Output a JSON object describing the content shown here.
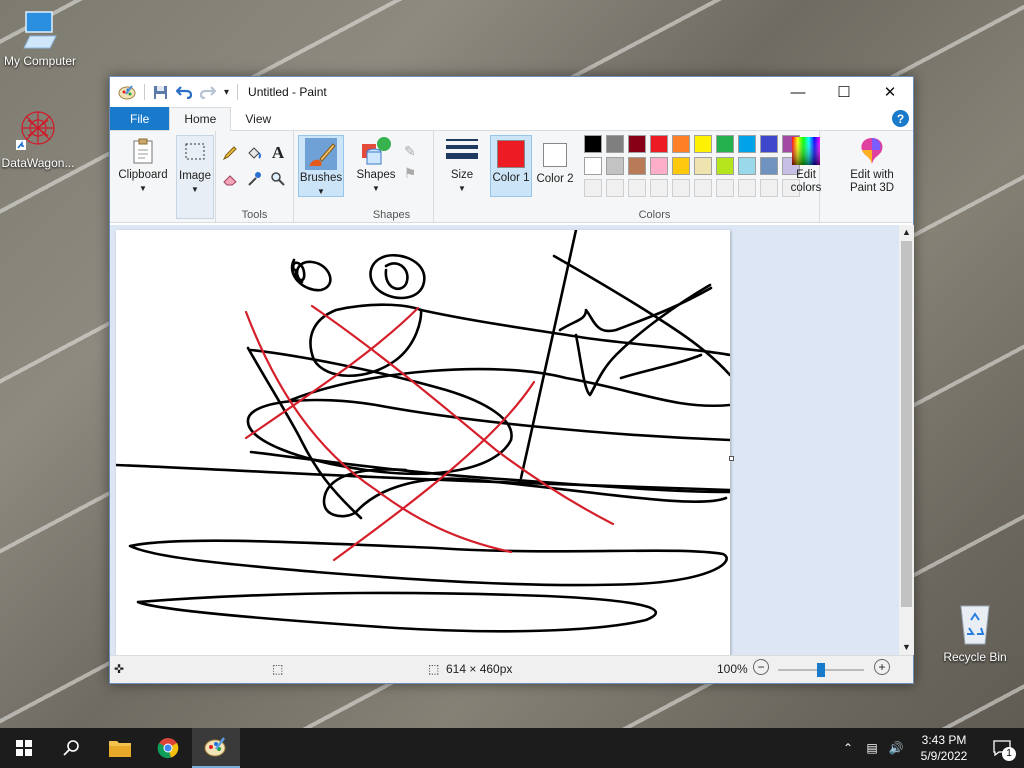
{
  "desktop": {
    "icons": [
      {
        "label": "My Computer",
        "icon": "computer-icon"
      },
      {
        "label": "DataWagon...",
        "icon": "datawagon-icon"
      },
      {
        "label": "Recycle Bin",
        "icon": "recycle-bin-icon"
      }
    ]
  },
  "window": {
    "title": "Untitled - Paint",
    "tabs": [
      "File",
      "Home",
      "View"
    ],
    "ribbon": {
      "clipboard": "Clipboard",
      "image": "Image",
      "tools_group": "Tools",
      "brushes": "Brushes",
      "shapes_btn": "Shapes",
      "shapes_group": "Shapes",
      "size": "Size",
      "color1": "Color 1",
      "color2": "Color 2",
      "colors_group": "Colors",
      "edit_colors": "Edit colors",
      "edit_paint3d": "Edit with Paint 3D",
      "color1_value": "#ed1c24",
      "color2_value": "#ffffff",
      "palette_row1": [
        "#000000",
        "#7f7f7f",
        "#880015",
        "#ed1c24",
        "#ff7f27",
        "#fff200",
        "#22b14c",
        "#00a2e8",
        "#3f48cc",
        "#a349a4"
      ],
      "palette_row2": [
        "#ffffff",
        "#c3c3c3",
        "#b97a57",
        "#ffaec9",
        "#ffc90e",
        "#efe4b0",
        "#b5e61d",
        "#99d9ea",
        "#7092be",
        "#c8bfe7"
      ]
    },
    "status": {
      "canvas_size": "614 × 460px",
      "zoom": "100%",
      "zoom_level": 1.0
    }
  },
  "taskbar": {
    "time": "3:43 PM",
    "date": "5/9/2022",
    "notification_count": "1"
  }
}
